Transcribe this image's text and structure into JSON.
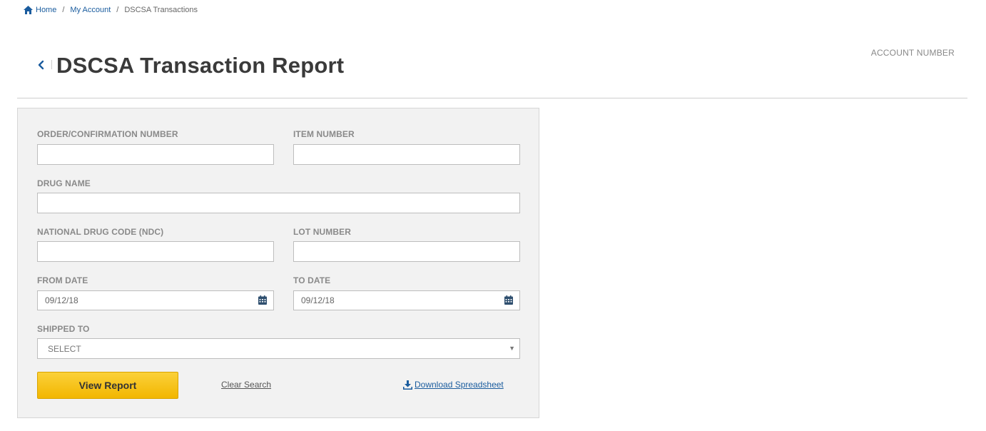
{
  "breadcrumb": {
    "home": "Home",
    "my_account": "My Account",
    "current": "DSCSA Transactions",
    "separator": "/"
  },
  "header": {
    "title": "DSCSA Transaction Report",
    "account_number_label": "ACCOUNT NUMBER"
  },
  "form": {
    "order_label": "ORDER/CONFIRMATION NUMBER",
    "order_value": "",
    "item_label": "ITEM NUMBER",
    "item_value": "",
    "drug_label": "DRUG NAME",
    "drug_value": "",
    "ndc_label": "NATIONAL DRUG CODE (NDC)",
    "ndc_value": "",
    "lot_label": "LOT NUMBER",
    "lot_value": "",
    "from_label": "FROM DATE",
    "from_value": "09/12/18",
    "to_label": "TO DATE",
    "to_value": "09/12/18",
    "shipped_label": "SHIPPED TO",
    "shipped_value": "SELECT"
  },
  "actions": {
    "view_report": "View Report",
    "clear_search": "Clear Search",
    "download": "Download Spreadsheet"
  },
  "colors": {
    "link": "#1a5c9e",
    "button": "#f2b600",
    "panel": "#f2f2f2"
  }
}
